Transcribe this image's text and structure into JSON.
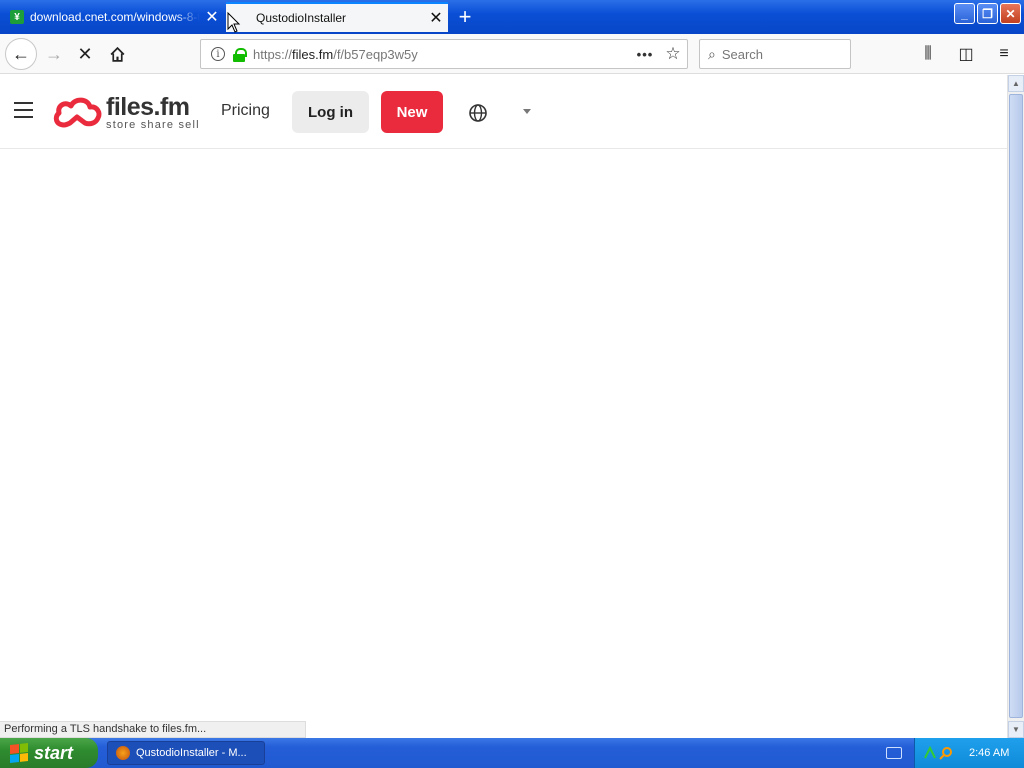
{
  "browser": {
    "tabs": [
      {
        "title": "download.cnet.com/windows-8-t",
        "favicon": "cnet-download-icon",
        "active": false
      },
      {
        "title": "QustodioInstaller",
        "active": true
      }
    ],
    "url_prefix": "https://",
    "url_host": "files.fm",
    "url_path": "/f/b57eqp3w5y",
    "search_placeholder": "Search",
    "status_text": "Performing a TLS handshake to files.fm..."
  },
  "site": {
    "logo_name": "files.fm",
    "logo_tagline": "store share sell",
    "nav": {
      "pricing": "Pricing",
      "login": "Log in",
      "new": "New"
    },
    "colors": {
      "brand_red": "#ea2b3d",
      "login_bg": "#ececec"
    }
  },
  "taskbar": {
    "start_label": "start",
    "task_label": "QustodioInstaller - M...",
    "clock": "2:46 AM"
  }
}
